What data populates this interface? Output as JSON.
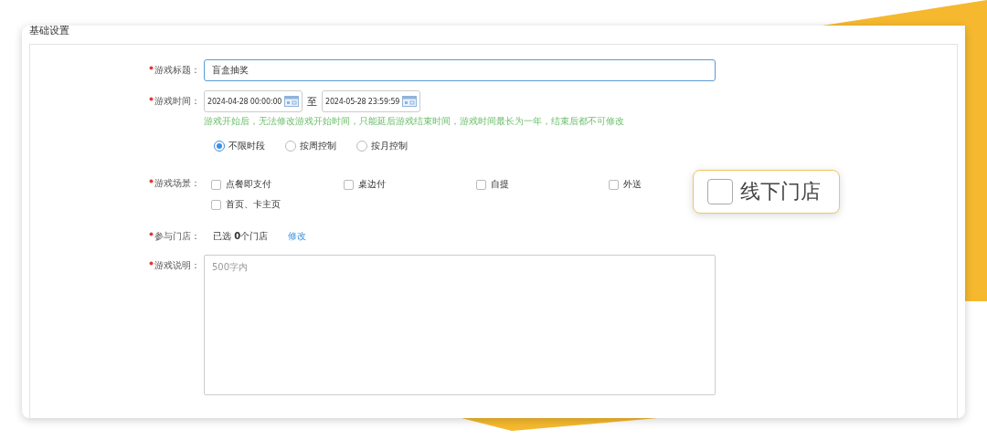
{
  "section_title": "基础设置",
  "rows": [
    {
      "kind": "text",
      "label": "游戏标题：",
      "required": true,
      "value": "盲盒抽奖",
      "focused": true
    },
    {
      "kind": "daterange",
      "label": "游戏时间：",
      "required": true,
      "start": "2024-04-28 00:00:00",
      "separator": "至",
      "end": "2024-05-28 23:59:59"
    },
    {
      "kind": "hint",
      "text": "游戏开始后，无法修改游戏开始时间，只能延后游戏结束时间，游戏时间最长为一年，结束后都不可修改"
    },
    {
      "kind": "radios",
      "options": [
        {
          "label": "不限时段",
          "selected": true
        },
        {
          "label": "按周控制",
          "selected": false
        },
        {
          "label": "按月控制",
          "selected": false
        }
      ]
    },
    {
      "kind": "checkboxes",
      "label": "游戏场景：",
      "required": true,
      "options": [
        {
          "label": "点餐即支付",
          "checked": false
        },
        {
          "label": "桌边付",
          "checked": false
        },
        {
          "label": "自提",
          "checked": false
        },
        {
          "label": "外送",
          "checked": false
        },
        {
          "label": "首页、卡主页",
          "checked": false
        }
      ]
    },
    {
      "kind": "stores",
      "label": "参与门店：",
      "required": true,
      "summary": "已选 **0**个门店",
      "link": "修改"
    },
    {
      "kind": "textarea",
      "label": "游戏说明：",
      "required": true,
      "placeholder": "500字内"
    }
  ],
  "callout": {
    "label": "线下门店",
    "checked": false
  }
}
